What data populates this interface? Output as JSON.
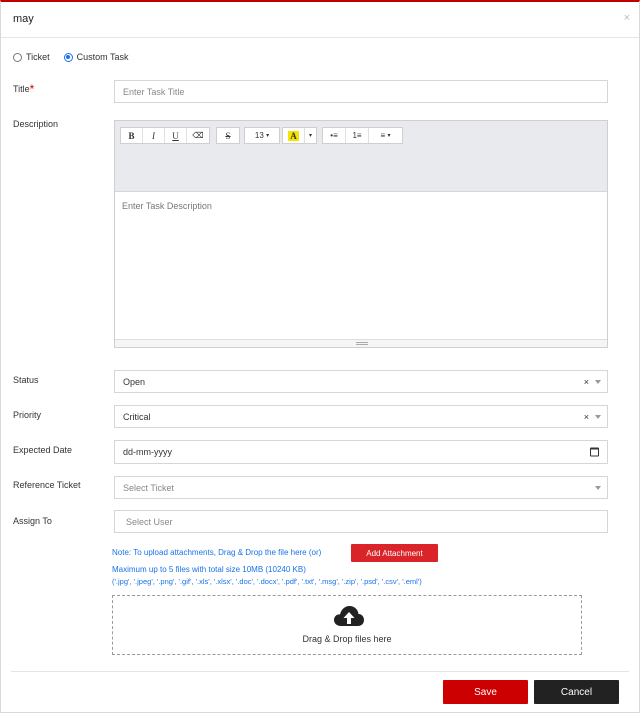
{
  "header": {
    "title": "may",
    "close_symbol": "×"
  },
  "task_type": {
    "options": [
      {
        "label": "Ticket",
        "checked": false
      },
      {
        "label": "Custom Task",
        "checked": true
      }
    ]
  },
  "form": {
    "title": {
      "label": "Title",
      "required_mark": "*",
      "placeholder": "Enter Task Title"
    },
    "description": {
      "label": "Description",
      "placeholder": "Enter Task Description",
      "toolbar": {
        "bold": "B",
        "italic": "I",
        "underline": "U",
        "eraser": "⌫",
        "strike": "S",
        "font_size": "13",
        "highlight": "A",
        "bullets": "•≡",
        "numbered": "1≡",
        "align": "≡"
      }
    },
    "status": {
      "label": "Status",
      "value": "Open"
    },
    "priority": {
      "label": "Priority",
      "value": "Critical"
    },
    "expected_date": {
      "label": "Expected Date",
      "placeholder": "dd-mm-yyyy"
    },
    "reference_ticket": {
      "label": "Reference Ticket",
      "placeholder": "Select Ticket"
    },
    "assign_to": {
      "label": "Assign To",
      "placeholder": "Select User"
    }
  },
  "attachments": {
    "note": "Note: To upload attachments, Drag & Drop the file here (or)",
    "button_label": "Add Attachment",
    "limit": "Maximum up to 5 files with total size 10MB (10240 KB)",
    "types": "('.jpg', '.jpeg', '.png', '.gif', '.xls', '.xlsx', '.doc', '.docx', '.pdf', '.txt', '.msg', '.zip', '.psd', '.csv', '.eml')",
    "dropzone_text": "Drag & Drop files here"
  },
  "footer": {
    "save_label": "Save",
    "cancel_label": "Cancel"
  },
  "colors": {
    "accent": "#cc0000",
    "link": "#1a73e8",
    "highlight": "#f5e400"
  }
}
